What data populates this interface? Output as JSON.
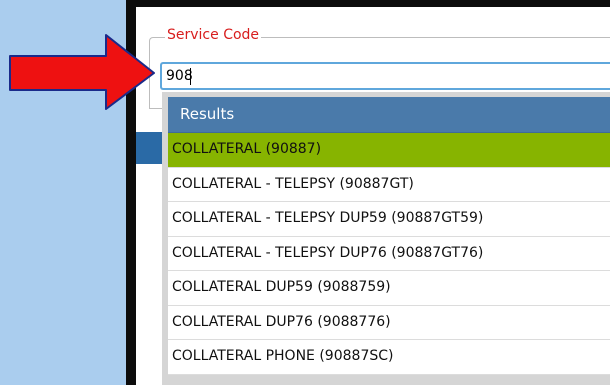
{
  "service_code": {
    "legend": "Service Code",
    "value": "908"
  },
  "results": {
    "header": "Results",
    "items": [
      "COLLATERAL (90887)",
      "COLLATERAL - TELEPSY (90887GT)",
      "COLLATERAL - TELEPSY DUP59 (90887GT59)",
      "COLLATERAL - TELEPSY DUP76 (90887GT76)",
      "COLLATERAL DUP59 (9088759)",
      "COLLATERAL DUP76 (9088776)",
      "COLLATERAL PHONE (90887SC)"
    ],
    "selected_index": 0
  },
  "colors": {
    "arrow": "#ee1111",
    "legend": "#d81e1e",
    "results_header_bg": "#4a7aaa",
    "selected_row_bg": "#87b400",
    "input_border": "#5fa7dc"
  },
  "icons": {
    "pointer": "arrow-right-icon"
  }
}
